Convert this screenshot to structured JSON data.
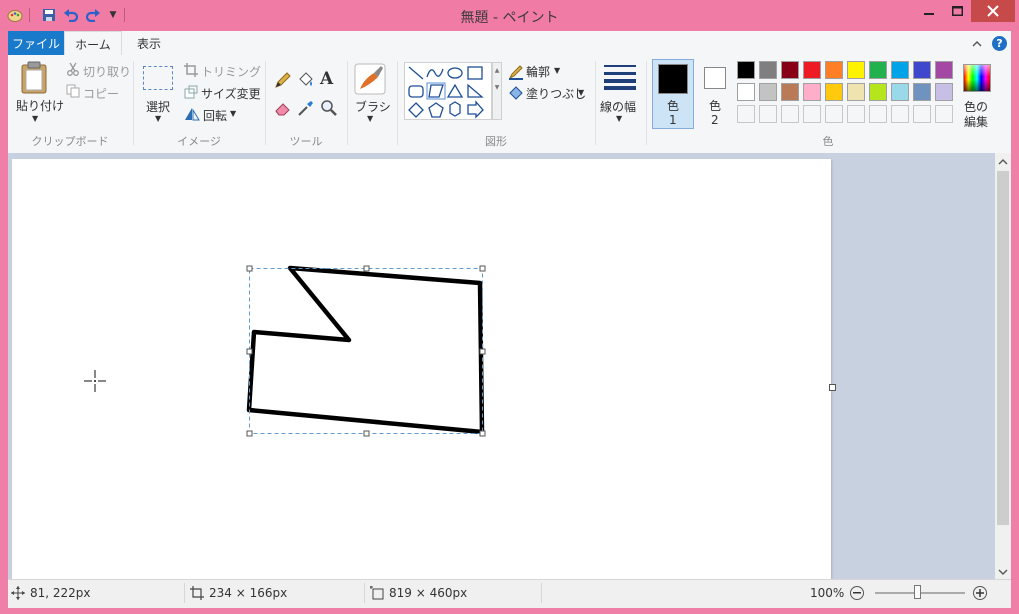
{
  "window": {
    "title": "無題 - ペイント"
  },
  "tabs": {
    "file": "ファイル",
    "home": "ホーム",
    "view": "表示"
  },
  "clipboard": {
    "paste": "貼り付け",
    "cut": "切り取り",
    "copy": "コピー",
    "group": "クリップボード"
  },
  "image": {
    "select": "選択",
    "crop": "トリミング",
    "resize": "サイズ変更",
    "rotate": "回転",
    "group": "イメージ"
  },
  "tools": {
    "group": "ツール",
    "text_glyph": "A"
  },
  "brushes": {
    "label": "ブラシ"
  },
  "shapes": {
    "outline": "輪郭",
    "fill": "塗りつぶし",
    "group": "図形"
  },
  "size": {
    "label": "線の幅"
  },
  "colors": {
    "color1_line1": "色",
    "color1_line2": "1",
    "color2_line1": "色",
    "color2_line2": "2",
    "edit_line1": "色の",
    "edit_line2": "編集",
    "group": "色",
    "color1_value": "#000000",
    "color2_value": "#ffffff",
    "palette_row1": [
      "#000000",
      "#7f7f7f",
      "#880015",
      "#ed1c24",
      "#ff7f27",
      "#fff200",
      "#22b14c",
      "#00a2e8",
      "#3f48cc",
      "#a349a4"
    ],
    "palette_row2": [
      "#ffffff",
      "#c3c3c3",
      "#b97a57",
      "#ffaec9",
      "#ffc90e",
      "#efe4b0",
      "#b5e61d",
      "#99d9ea",
      "#7092be",
      "#c8bfe7"
    ]
  },
  "status": {
    "cursor_pos": "81, 222px",
    "selection_size": "234 × 166px",
    "image_size": "819 × 460px",
    "zoom": "100%"
  }
}
